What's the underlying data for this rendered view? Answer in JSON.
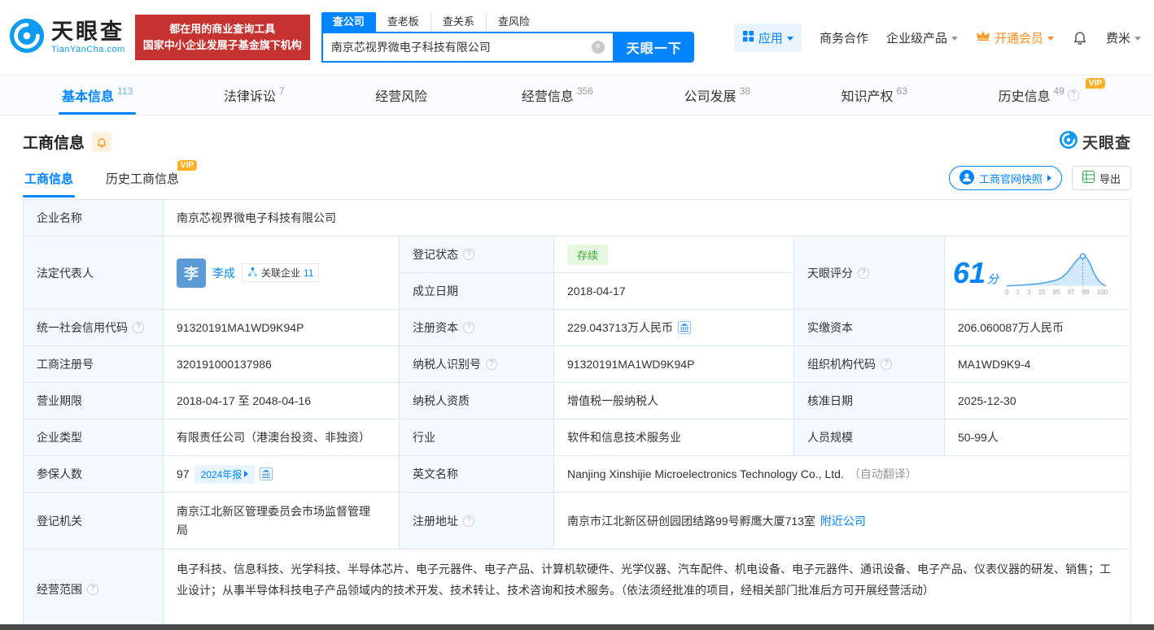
{
  "colors": {
    "primary_blue": "#0084ff",
    "banner_red": "#c5322f",
    "vip_orange": "#ffb125",
    "member_orange": "#ff8f1f",
    "status_green": "#3eaa30"
  },
  "header": {
    "logo": {
      "name": "天眼查",
      "domain": "TianYanCha.com"
    },
    "banner": {
      "line1": "都在用的商业查询工具",
      "line2": "国家中小企业发展子基金旗下机构"
    },
    "search": {
      "tabs": [
        {
          "label": "查公司"
        },
        {
          "label": "查老板"
        },
        {
          "label": "查关系"
        },
        {
          "label": "查风险"
        }
      ],
      "value": "南京芯视界微电子科技有限公司",
      "submit_label": "天眼一下"
    },
    "nav": {
      "apps_label": "应用",
      "business_label": "商务合作",
      "enterprise_label": "企业级产品",
      "vip_label": "开通会员",
      "user_label": "费米"
    }
  },
  "vip_badge": "VIP",
  "nav_tabs": [
    {
      "label": "基本信息",
      "count": "113"
    },
    {
      "label": "法律诉讼",
      "count": "7"
    },
    {
      "label": "经营风险",
      "count": ""
    },
    {
      "label": "经营信息",
      "count": "356"
    },
    {
      "label": "公司发展",
      "count": "38"
    },
    {
      "label": "知识产权",
      "count": "63"
    },
    {
      "label": "历史信息",
      "count": "49"
    }
  ],
  "section": {
    "title": "工商信息",
    "brand": "天眼查",
    "subtabs": [
      {
        "label": "工商信息"
      },
      {
        "label": "历史工商信息"
      }
    ],
    "snapshot_label": "工商官网快照",
    "export_label": "导出"
  },
  "info": {
    "name_label": "企业名称",
    "name": "南京芯视界微电子科技有限公司",
    "legal_rep_label": "法定代表人",
    "legal_rep_avatar": "李",
    "legal_rep": "李成",
    "related_label": "关联企业",
    "related_count": "11",
    "reg_status_label": "登记状态",
    "reg_status": "存续",
    "establish_label": "成立日期",
    "establish_date": "2018-04-17",
    "score_label": "天眼评分",
    "score": "61",
    "score_unit": "分",
    "score_ticks": [
      "0",
      "1",
      "3",
      "15",
      "85",
      "97",
      "99",
      "100"
    ],
    "credit_code_label": "统一社会信用代码",
    "credit_code": "91320191MA1WD9K94P",
    "reg_capital_label": "注册资本",
    "reg_capital": "229.043713万人民币",
    "paid_capital_label": "实缴资本",
    "paid_capital": "206.060087万人民币",
    "reg_number_label": "工商注册号",
    "reg_number": "320191000137986",
    "taxpayer_id_label": "纳税人识别号",
    "taxpayer_id": "91320191MA1WD9K94P",
    "org_code_label": "组织机构代码",
    "org_code": "MA1WD9K9-4",
    "term_label": "营业期限",
    "term": "2018-04-17 至 2048-04-16",
    "taxpayer_quality_label": "纳税人资质",
    "taxpayer_quality": "增值税一般纳税人",
    "approval_label": "核准日期",
    "approval_date": "2025-12-30",
    "type_label": "企业类型",
    "type": "有限责任公司（港澳台投资、非独资）",
    "industry_label": "行业",
    "industry": "软件和信息技术服务业",
    "staff_label": "人员规模",
    "staff": "50-99人",
    "insured_label": "参保人数",
    "insured": "97",
    "annual_report": "2024年报",
    "english_label": "英文名称",
    "english_name": "Nanjing Xinshijie Microelectronics Technology Co., Ltd.",
    "auto_translate": "（自动翻译）",
    "registry_label": "登记机关",
    "registry": "南京江北新区管理委员会市场监督管理局",
    "address_label": "注册地址",
    "address": "南京市江北新区研创园团结路99号孵鹰大厦713室",
    "nearby": "附近公司",
    "scope_label": "经营范围",
    "scope": "电子科技、信息科技、光学科技、半导体芯片、电子元器件、电子产品、计算机软硬件、光学仪器、汽车配件、机电设备、电子元器件、通讯设备、电子产品、仪表仪器的研发、销售；工业设计；从事半导体科技电子产品领域内的技术开发、技术转让、技术咨询和技术服务。（依法须经批准的项目，经相关部门批准后方可开展经营活动）"
  }
}
